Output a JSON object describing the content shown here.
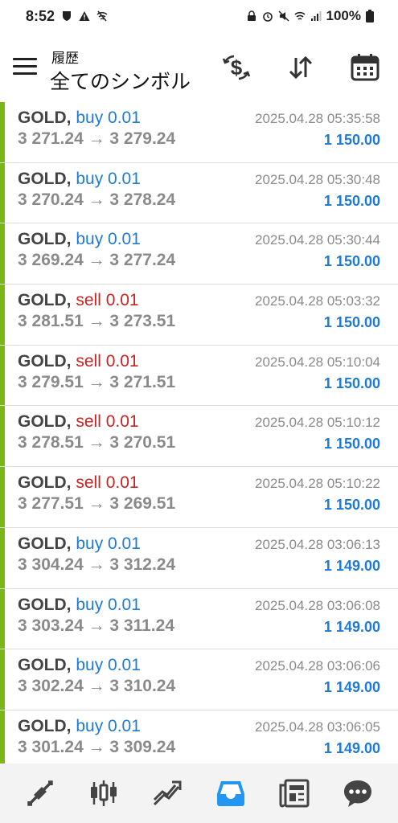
{
  "status": {
    "time": "8:52",
    "battery": "100%"
  },
  "header": {
    "subtitle": "履歴",
    "title": "全てのシンボル"
  },
  "trades": [
    {
      "symbol": "GOLD,",
      "side": "buy 0.01",
      "type": "buy",
      "prices": "3 271.24 → 3 279.24",
      "time": "2025.04.28 05:35:58",
      "profit": "1 150.00"
    },
    {
      "symbol": "GOLD,",
      "side": "buy 0.01",
      "type": "buy",
      "prices": "3 270.24 → 3 278.24",
      "time": "2025.04.28 05:30:48",
      "profit": "1 150.00"
    },
    {
      "symbol": "GOLD,",
      "side": "buy 0.01",
      "type": "buy",
      "prices": "3 269.24 → 3 277.24",
      "time": "2025.04.28 05:30:44",
      "profit": "1 150.00"
    },
    {
      "symbol": "GOLD,",
      "side": "sell 0.01",
      "type": "sell",
      "prices": "3 281.51 → 3 273.51",
      "time": "2025.04.28 05:03:32",
      "profit": "1 150.00"
    },
    {
      "symbol": "GOLD,",
      "side": "sell 0.01",
      "type": "sell",
      "prices": "3 279.51 → 3 271.51",
      "time": "2025.04.28 05:10:04",
      "profit": "1 150.00"
    },
    {
      "symbol": "GOLD,",
      "side": "sell 0.01",
      "type": "sell",
      "prices": "3 278.51 → 3 270.51",
      "time": "2025.04.28 05:10:12",
      "profit": "1 150.00"
    },
    {
      "symbol": "GOLD,",
      "side": "sell 0.01",
      "type": "sell",
      "prices": "3 277.51 → 3 269.51",
      "time": "2025.04.28 05:10:22",
      "profit": "1 150.00"
    },
    {
      "symbol": "GOLD,",
      "side": "buy 0.01",
      "type": "buy",
      "prices": "3 304.24 → 3 312.24",
      "time": "2025.04.28 03:06:13",
      "profit": "1 149.00"
    },
    {
      "symbol": "GOLD,",
      "side": "buy 0.01",
      "type": "buy",
      "prices": "3 303.24 → 3 311.24",
      "time": "2025.04.28 03:06:08",
      "profit": "1 149.00"
    },
    {
      "symbol": "GOLD,",
      "side": "buy 0.01",
      "type": "buy",
      "prices": "3 302.24 → 3 310.24",
      "time": "2025.04.28 03:06:06",
      "profit": "1 149.00"
    },
    {
      "symbol": "GOLD,",
      "side": "buy 0.01",
      "type": "buy",
      "prices": "3 301.24 → 3 309.24",
      "time": "2025.04.28 03:06:05",
      "profit": "1 149.00"
    }
  ],
  "colors": {
    "accent": "#2196f3",
    "buy": "#1e7ad4",
    "sell": "#cc2222",
    "row_bar": "#7cb518",
    "profit": "#1e7ad4"
  },
  "icons": {
    "header": [
      "exchange-dollar-icon",
      "sort-icon",
      "calendar-icon"
    ],
    "nav": [
      "quotes-icon",
      "chart-icon",
      "trade-icon",
      "history-icon",
      "news-icon",
      "chat-icon"
    ],
    "nav_active": "history-icon"
  }
}
